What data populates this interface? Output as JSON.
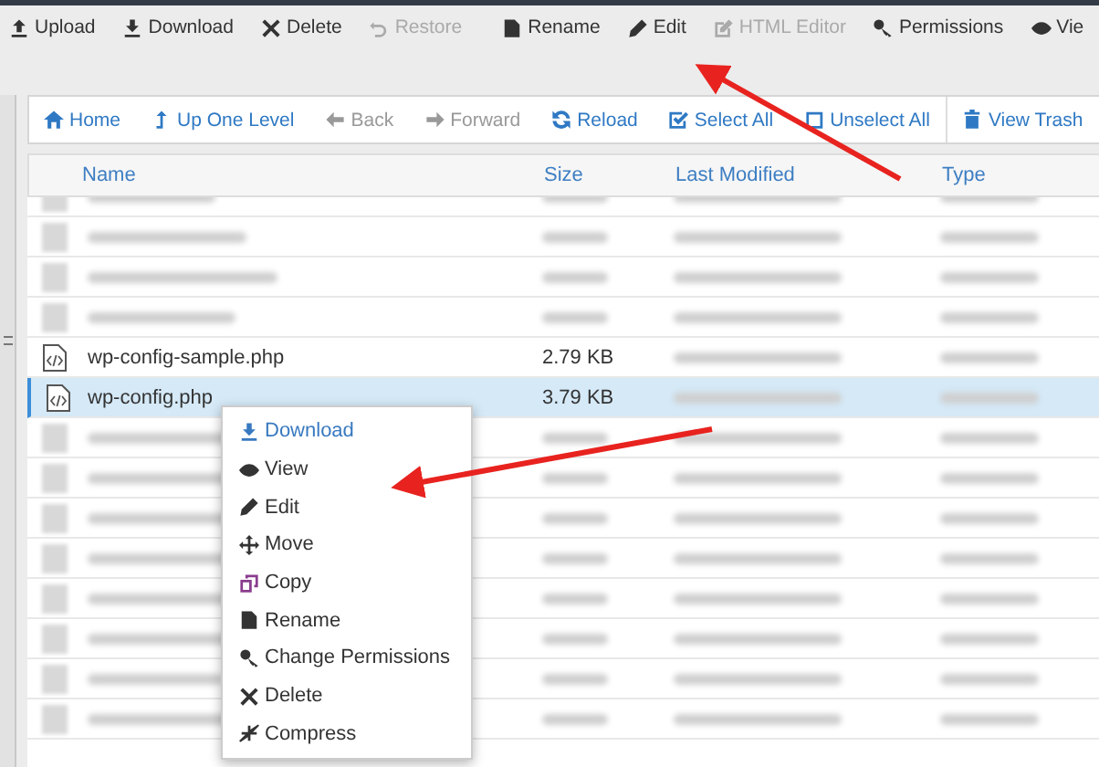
{
  "toolbar": [
    {
      "label": "Upload",
      "disabled": false
    },
    {
      "label": "Download",
      "disabled": false
    },
    {
      "label": "Delete",
      "disabled": false
    },
    {
      "label": "Restore",
      "disabled": true
    },
    {
      "label": "Rename",
      "disabled": false
    },
    {
      "label": "Edit",
      "disabled": false
    },
    {
      "label": "HTML Editor",
      "disabled": true
    },
    {
      "label": "Permissions",
      "disabled": false
    },
    {
      "label": "Vie",
      "disabled": false
    }
  ],
  "nav": [
    {
      "label": "Home",
      "disabled": false
    },
    {
      "label": "Up One Level",
      "disabled": false
    },
    {
      "label": "Back",
      "disabled": true
    },
    {
      "label": "Forward",
      "disabled": true
    },
    {
      "label": "Reload",
      "disabled": false
    },
    {
      "label": "Select All",
      "disabled": false
    },
    {
      "label": "Unselect All",
      "disabled": false
    },
    {
      "label": "View Trash",
      "disabled": false
    }
  ],
  "table": {
    "columns": [
      "Name",
      "Size",
      "Last Modified",
      "Type"
    ],
    "rows": [
      {
        "selected": false
      },
      {
        "selected": false
      },
      {
        "selected": false
      },
      {
        "selected": false
      },
      {
        "name": "wp-config-sample.php",
        "size": "2.79 KB",
        "selected": false
      },
      {
        "name": "wp-config.php",
        "size": "3.79 KB",
        "selected": true
      },
      {
        "selected": false
      },
      {
        "selected": false
      },
      {
        "selected": false
      },
      {
        "selected": false
      },
      {
        "selected": false
      },
      {
        "selected": false
      },
      {
        "selected": false
      },
      {
        "selected": false
      }
    ]
  },
  "context_menu": [
    {
      "label": "Download",
      "selected": true
    },
    {
      "label": "View",
      "selected": false
    },
    {
      "label": "Edit",
      "selected": false
    },
    {
      "label": "Move",
      "selected": false
    },
    {
      "label": "Copy",
      "selected": false
    },
    {
      "label": "Rename",
      "selected": false
    },
    {
      "label": "Change Permissions",
      "selected": false
    },
    {
      "label": "Delete",
      "selected": false
    },
    {
      "label": "Compress",
      "selected": false
    }
  ]
}
